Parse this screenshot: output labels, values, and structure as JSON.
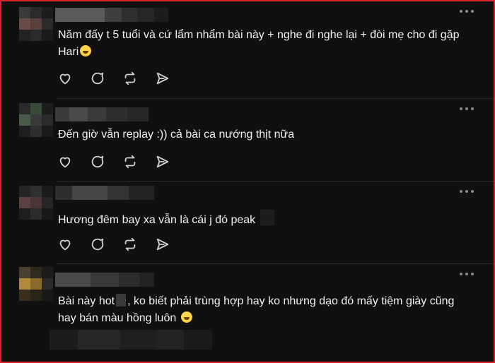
{
  "comments": [
    {
      "text": "Năm đấy t 5 tuổi và cứ lẩm nhẩm bài này + nghe đi nghe lại + đòi mẹ cho đi gặp Hari"
    },
    {
      "text": "Đến giờ vẫn replay :)) cả bài ca nướng thịt nữa"
    },
    {
      "text": "Hương đêm bay xa vẫn là cái j đó peak"
    },
    {
      "text_before": "Bài này hot",
      "text_after": ", ko biết phải trùng hợp hay ko nhưng dạo đó mấy tiệm giày cũng hay bán màu hồng luôn"
    }
  ],
  "actions": [
    "heart-icon",
    "reply-icon",
    "repost-icon",
    "share-icon"
  ],
  "colors": {
    "background": "#101010",
    "text": "#f2f2f2",
    "icon": "#d0d0d0",
    "frame_border": "#d8232a"
  }
}
